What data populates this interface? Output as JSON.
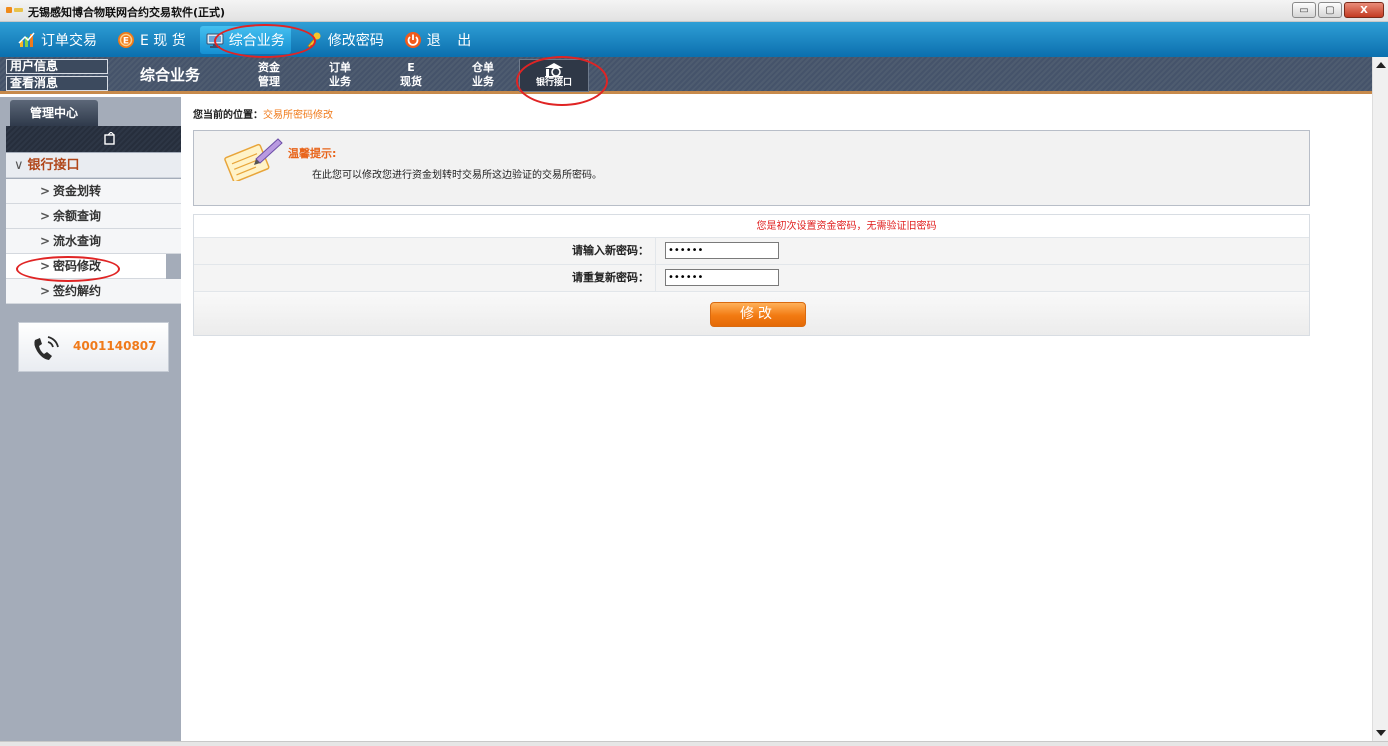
{
  "window": {
    "title": "无锡感知博合物联网合约交易软件(正式)",
    "buttons": {
      "minimize": "▭",
      "maximize": "▢",
      "close": "X"
    }
  },
  "menubar": {
    "items": [
      {
        "label": "订单交易",
        "icon": "chart-icon"
      },
      {
        "label": "E 现 货",
        "icon": "e-circle-icon"
      },
      {
        "label": "综合业务",
        "icon": "monitor-icon",
        "active": true
      },
      {
        "label": "修改密码",
        "icon": "key-icon"
      },
      {
        "label": "退 出",
        "icon": "power-icon"
      }
    ]
  },
  "subnav": {
    "user_info": "用户信息",
    "view_messages": "查看消息",
    "section_title": "综合业务",
    "items": [
      {
        "line1": "资金",
        "line2": "管理"
      },
      {
        "line1": "订单",
        "line2": "业务"
      },
      {
        "line1": "E",
        "line2": "现货"
      },
      {
        "line1": "仓单",
        "line2": "业务"
      }
    ],
    "bank_item": "银行接口"
  },
  "sidebar": {
    "tab": "管理中心",
    "group": "银行接口",
    "items": [
      "资金划转",
      "余额查询",
      "流水查询",
      "密码修改",
      "签约解约"
    ],
    "active_index": 3,
    "hotline": "4001140807"
  },
  "content": {
    "breadcrumb_label": "您当前的位置：",
    "breadcrumb_value": "交易所密码修改",
    "tip_title": "温馨提示:",
    "tip_text": "在此您可以修改您进行资金划转时交易所这边验证的交易所密码。",
    "notice": "您是初次设置资金密码，无需验证旧密码",
    "new_password_label": "请输入新密码：",
    "new_password_value": "••••••",
    "repeat_password_label": "请重复新密码：",
    "repeat_password_value": "••••••",
    "submit_label": "修改"
  },
  "colors": {
    "menubar": "#0b6fae",
    "accent_orange": "#f07a1a",
    "notice_red": "#e02020",
    "annotation_red": "#e02424"
  }
}
